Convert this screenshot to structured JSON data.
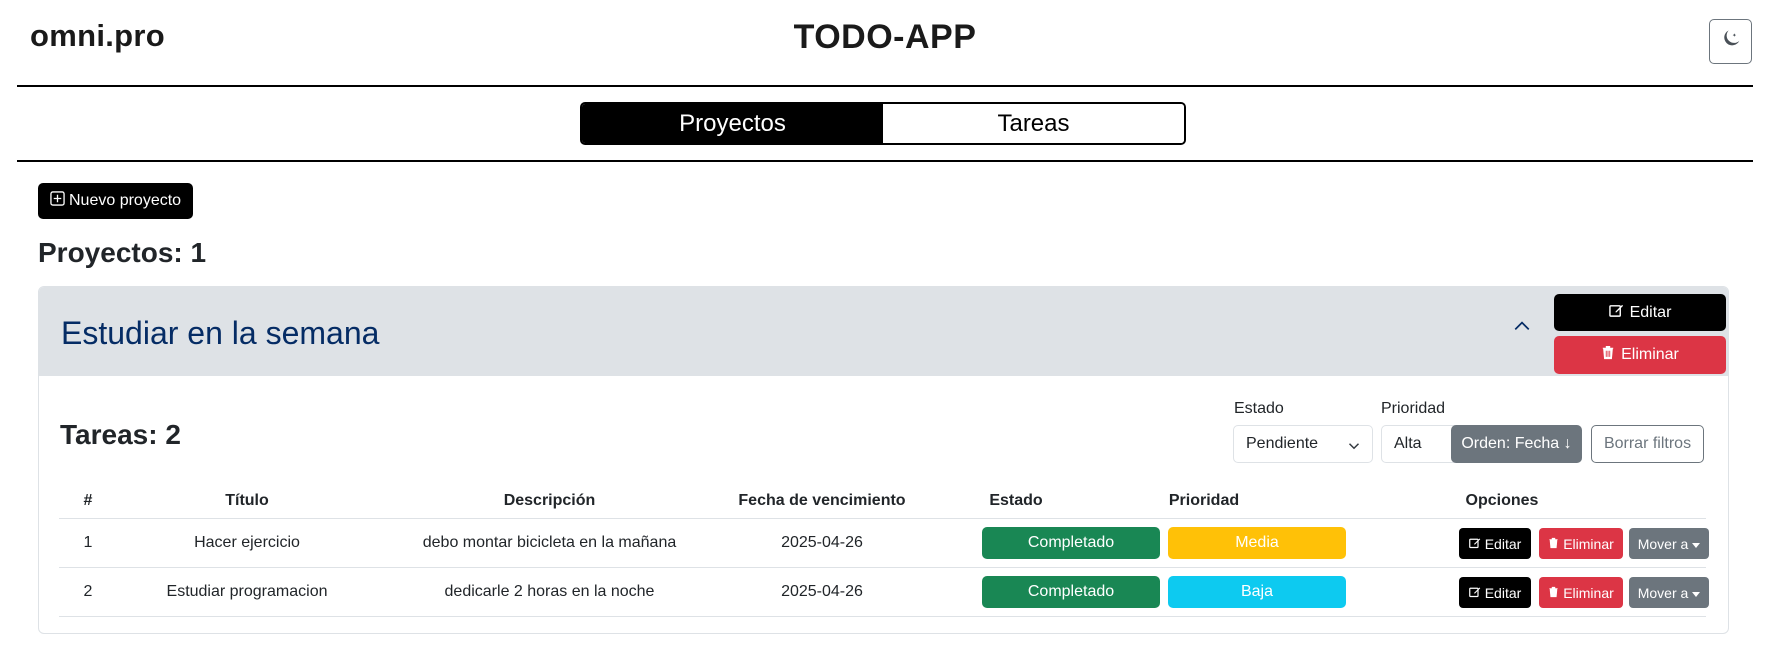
{
  "header": {
    "logo": "omni.pro",
    "title": "TODO-APP",
    "theme_icon": "moon-stars-icon"
  },
  "view_switcher": {
    "tabs": [
      {
        "label": "Proyectos",
        "active": true
      },
      {
        "label": "Tareas",
        "active": false
      }
    ]
  },
  "new_project_label": "Nuevo proyecto",
  "projects_count": {
    "label": "Proyectos:",
    "value": "1"
  },
  "project": {
    "title": "Estudiar en la semana",
    "edit_label": "Editar",
    "delete_label": "Eliminar",
    "tasks_count": {
      "label": "Tareas:",
      "value": "2"
    },
    "filters": {
      "estado_label": "Estado",
      "estado_value": "Pendiente",
      "prioridad_label": "Prioridad",
      "prioridad_value": "Alta",
      "order_label": "Orden: Fecha ↓",
      "clear_label": "Borrar filtros"
    },
    "table": {
      "headers": [
        "#",
        "Título",
        "Descripción",
        "Fecha de vencimiento",
        "Estado",
        "Prioridad",
        "Opciones"
      ],
      "rows": [
        {
          "num": "1",
          "title": "Hacer ejercicio",
          "description": "debo montar bicicleta en la mañana",
          "due": "2025-04-26",
          "status": "Completado",
          "priority": "Media",
          "priority_color": "#ffc107"
        },
        {
          "num": "2",
          "title": "Estudiar programacion",
          "description": "dedicarle 2 horas en la noche",
          "due": "2025-04-26",
          "status": "Completado",
          "priority": "Baja",
          "priority_color": "#0dcaf0"
        }
      ],
      "row_actions": {
        "edit": "Editar",
        "delete": "Eliminar",
        "move": "Mover a"
      }
    }
  }
}
